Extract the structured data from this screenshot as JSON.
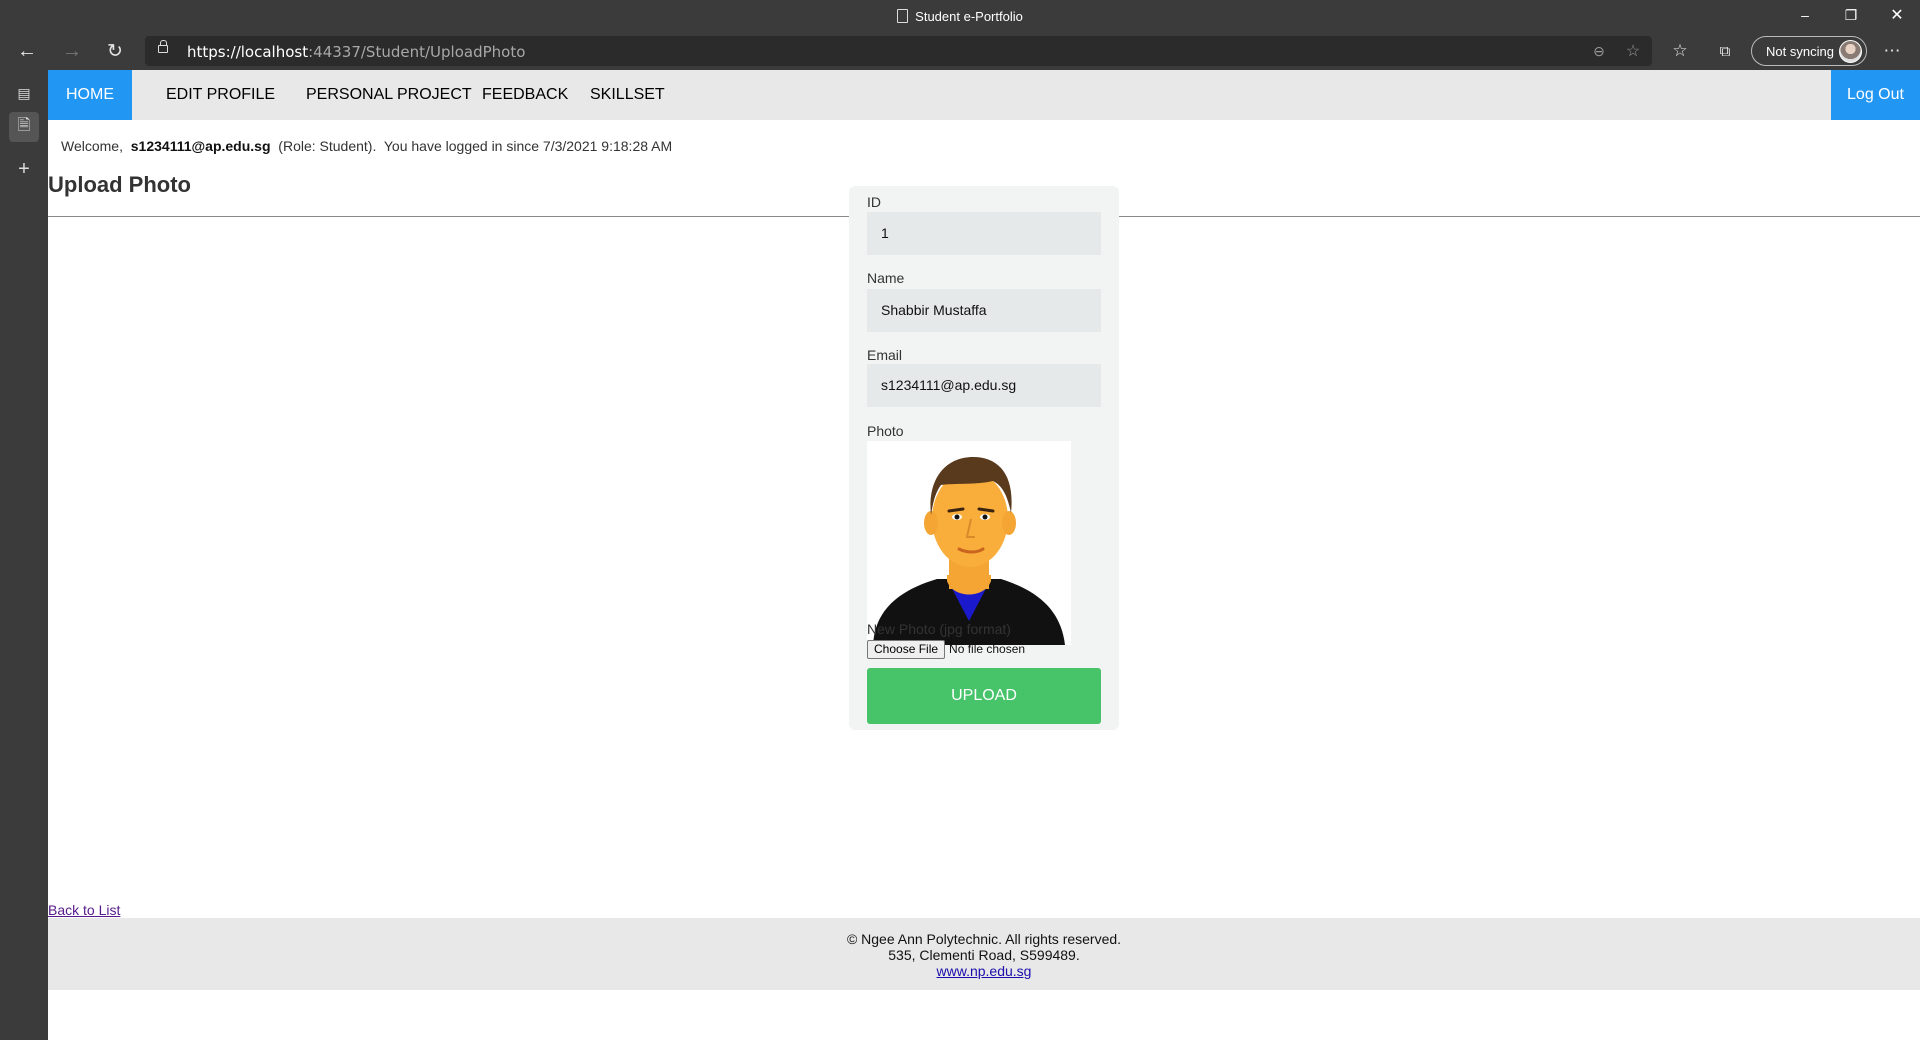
{
  "browser": {
    "window_title": "Student e-Portfolio",
    "url_host": "https://localhost",
    "url_path": ":44337/Student/UploadPhoto",
    "sync_label": "Not syncing"
  },
  "nav": {
    "items": [
      "HOME",
      "EDIT PROFILE",
      "PERSONAL PROJECT",
      "FEEDBACK",
      "SKILLSET"
    ],
    "active": "HOME",
    "logout": "Log Out"
  },
  "welcome": {
    "prefix": "Welcome,",
    "email": "s1234111@ap.edu.sg",
    "suffix": "(Role: Student).  You have logged in since 7/3/2021 9:18:28 AM"
  },
  "page_title": "Upload Photo",
  "form": {
    "id_label": "ID",
    "id_value": "1",
    "name_label": "Name",
    "name_value": "Shabbir Mustaffa",
    "email_label": "Email",
    "email_value": "s1234111@ap.edu.sg",
    "photo_label": "Photo",
    "new_photo_label": "New Photo (jpg format)",
    "choose_file": "Choose File",
    "no_file": "No file chosen",
    "upload": "UPLOAD"
  },
  "back_link": "Back to List",
  "footer": {
    "line1": "© Ngee Ann Polytechnic. All rights reserved.",
    "line2": "535, Clementi Road, S599489.",
    "link": "www.np.edu.sg"
  }
}
